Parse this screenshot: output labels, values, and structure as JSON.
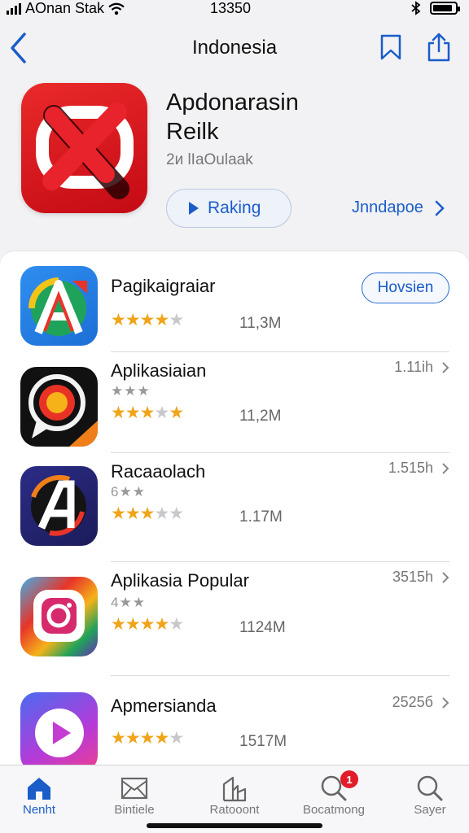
{
  "status_bar": {
    "carrier": "AOnan Stak",
    "time": "13350"
  },
  "nav": {
    "title": "Indonesia"
  },
  "hero": {
    "title_line1": "Apdonarasin",
    "title_line2": "Reilk",
    "subtitle": "2и lIaOulaak",
    "rank_button": "Raking",
    "link_label": "Jnndapoe"
  },
  "apps": [
    {
      "name": "Pagikaigraiar",
      "rating_text": "",
      "stars": 4,
      "count": "11,3M",
      "meta": "",
      "action": "Hovsien"
    },
    {
      "name": "Aplikasiaian",
      "rating_text": "★★★",
      "stars": 3.5,
      "count": "11,2M",
      "meta": "1.11ih",
      "action": ""
    },
    {
      "name": "Racaaolach",
      "rating_text": "6★★",
      "stars": 3.5,
      "count": "1.17M",
      "meta": "1.515h",
      "action": ""
    },
    {
      "name": "Aplikasia Popular",
      "rating_text": "4★★",
      "stars": 4,
      "count": "1124M",
      "meta": "3515h",
      "action": ""
    },
    {
      "name": "Apmersianda",
      "rating_text": "",
      "stars": 4,
      "count": "1517M",
      "meta": "2525б",
      "action": ""
    }
  ],
  "tabs": [
    {
      "label": "Nenht",
      "icon": "home-icon",
      "active": true
    },
    {
      "label": "Bintiele",
      "icon": "mail-icon",
      "active": false
    },
    {
      "label": "Ratooont",
      "icon": "chart-icon",
      "active": false
    },
    {
      "label": "Bocatmong",
      "icon": "search-icon",
      "active": false,
      "badge": "1"
    },
    {
      "label": "Sayer",
      "icon": "search-icon",
      "active": false
    }
  ],
  "colors": {
    "accent": "#1a5dc9",
    "star": "#f0a418",
    "badge": "#e11d2a",
    "hero_icon": "#d8141c"
  }
}
